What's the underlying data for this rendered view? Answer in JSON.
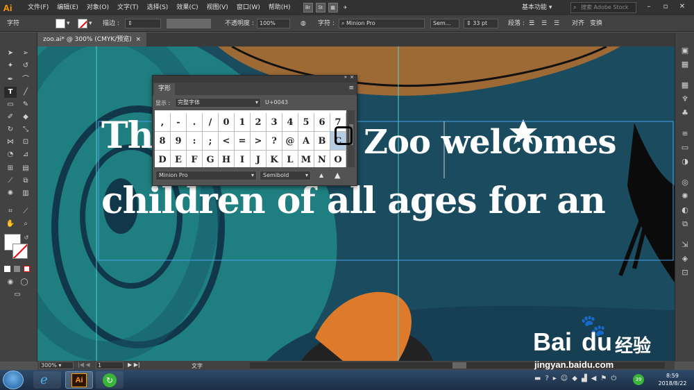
{
  "app": {
    "logo": "Ai"
  },
  "menubar": {
    "items": [
      "文件(F)",
      "编辑(E)",
      "对象(O)",
      "文字(T)",
      "选择(S)",
      "效果(C)",
      "视图(V)",
      "窗口(W)",
      "帮助(H)"
    ],
    "bridge_icons": [
      "Br",
      "St"
    ],
    "workspace": "基本功能",
    "stock_search_placeholder": "搜索 Adobe Stock"
  },
  "control_bar": {
    "mode_label": "字符",
    "stroke_label": "描边 :",
    "opacity_label": "不透明度 :",
    "opacity_value": "100%",
    "char_label": "字符 :",
    "font_value": "Minion Pro",
    "style_value": "Sem...",
    "size_value": "33 pt",
    "paragraph_label": "段落 :",
    "align_label": "对齐",
    "transform_label": "变换"
  },
  "document": {
    "tab_title": "zoo.ai* @ 300% (CMYK/预览)",
    "close_glyph": "×"
  },
  "artboard_text": {
    "line1_left": "Th",
    "line1_right": "Zoo welcomes",
    "line2": "children of all ages for an"
  },
  "glyphs_panel": {
    "title": "字形",
    "show_label": "显示 :",
    "show_value": "完整字体",
    "code": "U+0043",
    "rows": [
      [
        ",",
        "-",
        ".",
        "/",
        "0",
        "1",
        "2",
        "3",
        "4",
        "5",
        "6",
        "7"
      ],
      [
        "8",
        "9",
        ":",
        ";",
        "<",
        "=",
        ">",
        "?",
        "@",
        "A",
        "B",
        "C"
      ],
      [
        "D",
        "E",
        "F",
        "G",
        "H",
        "I",
        "J",
        "K",
        "L",
        "M",
        "N",
        "O"
      ]
    ],
    "selected_glyph": "C",
    "font": "Minion Pro",
    "style": "Semibold"
  },
  "statusbar": {
    "zoom": "300%",
    "page": "1",
    "tool_label": "文字"
  },
  "taskbar": {
    "time": "8:59",
    "date": "2018/8/22",
    "badge": "39"
  },
  "watermark": {
    "brand": "Bai",
    "brand2": "du",
    "cn": "经验",
    "url": "jingyan.baidu.com"
  },
  "colors": {
    "accent_orange": "#ff9a00",
    "canvas_teal": "#1c4a5e",
    "selection_blue": "#4aa3e8"
  }
}
